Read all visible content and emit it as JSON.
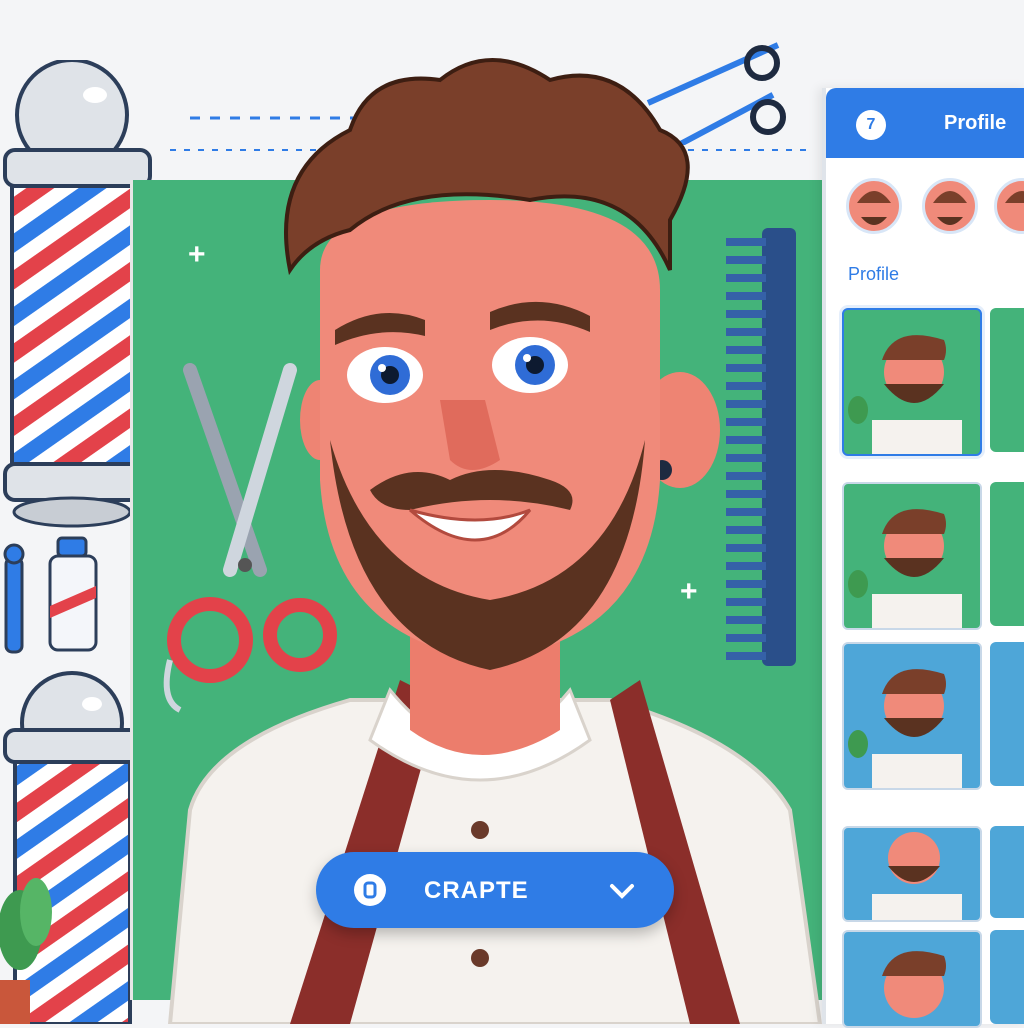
{
  "header": {
    "title": "Profile",
    "logo_glyph": "7"
  },
  "sidebar": {
    "section_label": "Profile",
    "avatars": [
      "avatar-1",
      "avatar-2",
      "avatar-3"
    ],
    "thumbnails": [
      {
        "id": "thumb-1",
        "selected": true,
        "bg": "#44b37a"
      },
      {
        "id": "thumb-2",
        "selected": false,
        "bg": "#44b37a"
      },
      {
        "id": "thumb-3",
        "selected": false,
        "bg": "#44b37a"
      },
      {
        "id": "thumb-4",
        "selected": false,
        "bg": "#4ea6d8"
      },
      {
        "id": "thumb-5",
        "selected": false,
        "bg": "#4ea6d8"
      }
    ]
  },
  "main": {
    "create_button_label": "CRAPTE",
    "icons": [
      "barber-pole-icon",
      "scissors-icon",
      "comb-icon",
      "clipper-icon",
      "bottle-icon",
      "plus-icon",
      "plant-icon"
    ]
  },
  "colors": {
    "accent": "#2f7ce6",
    "canvas": "#44b37a",
    "apron": "#8b2e2a",
    "beard": "#5a3220",
    "skin": "#f08a7a"
  }
}
